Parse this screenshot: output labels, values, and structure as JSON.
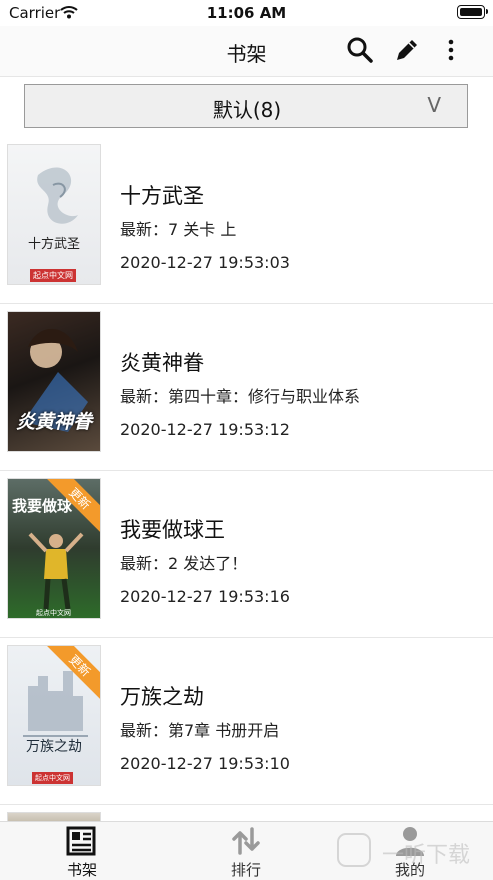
{
  "status": {
    "carrier": "Carrier",
    "time": "11:06 AM"
  },
  "nav": {
    "title": "书架"
  },
  "filter": {
    "label": "默认(8)",
    "chevron": "V"
  },
  "books": [
    {
      "title": "十方武圣",
      "latest": "最新：7 关卡 上",
      "date": "2020-12-27 19:53:03",
      "cover_title": "十方武圣",
      "cover_publisher": "起点中文网",
      "updated": false
    },
    {
      "title": "炎黄神眷",
      "latest": "最新：第四十章：修行与职业体系",
      "date": "2020-12-27 19:53:12",
      "cover_title": "炎黄神眷",
      "cover_publisher": "",
      "updated": false
    },
    {
      "title": "我要做球王",
      "latest": "最新：2 发达了！",
      "date": "2020-12-27 19:53:16",
      "cover_title": "我要做球",
      "cover_publisher": "起点中文网",
      "updated": true
    },
    {
      "title": "万族之劫",
      "latest": "最新：第7章 书册开启",
      "date": "2020-12-27 19:53:10",
      "cover_title": "万族之劫",
      "cover_publisher": "起点中文网",
      "updated": true
    }
  ],
  "cover_badge": "更新",
  "tabs": [
    {
      "label": "书架",
      "active": true
    },
    {
      "label": "排行",
      "active": false
    },
    {
      "label": "我的",
      "active": false
    }
  ],
  "watermark": "一听下载",
  "colors": {
    "active_tab": "#111111",
    "inactive_tab": "#9a9a9a",
    "badge": "#f39a2b"
  }
}
